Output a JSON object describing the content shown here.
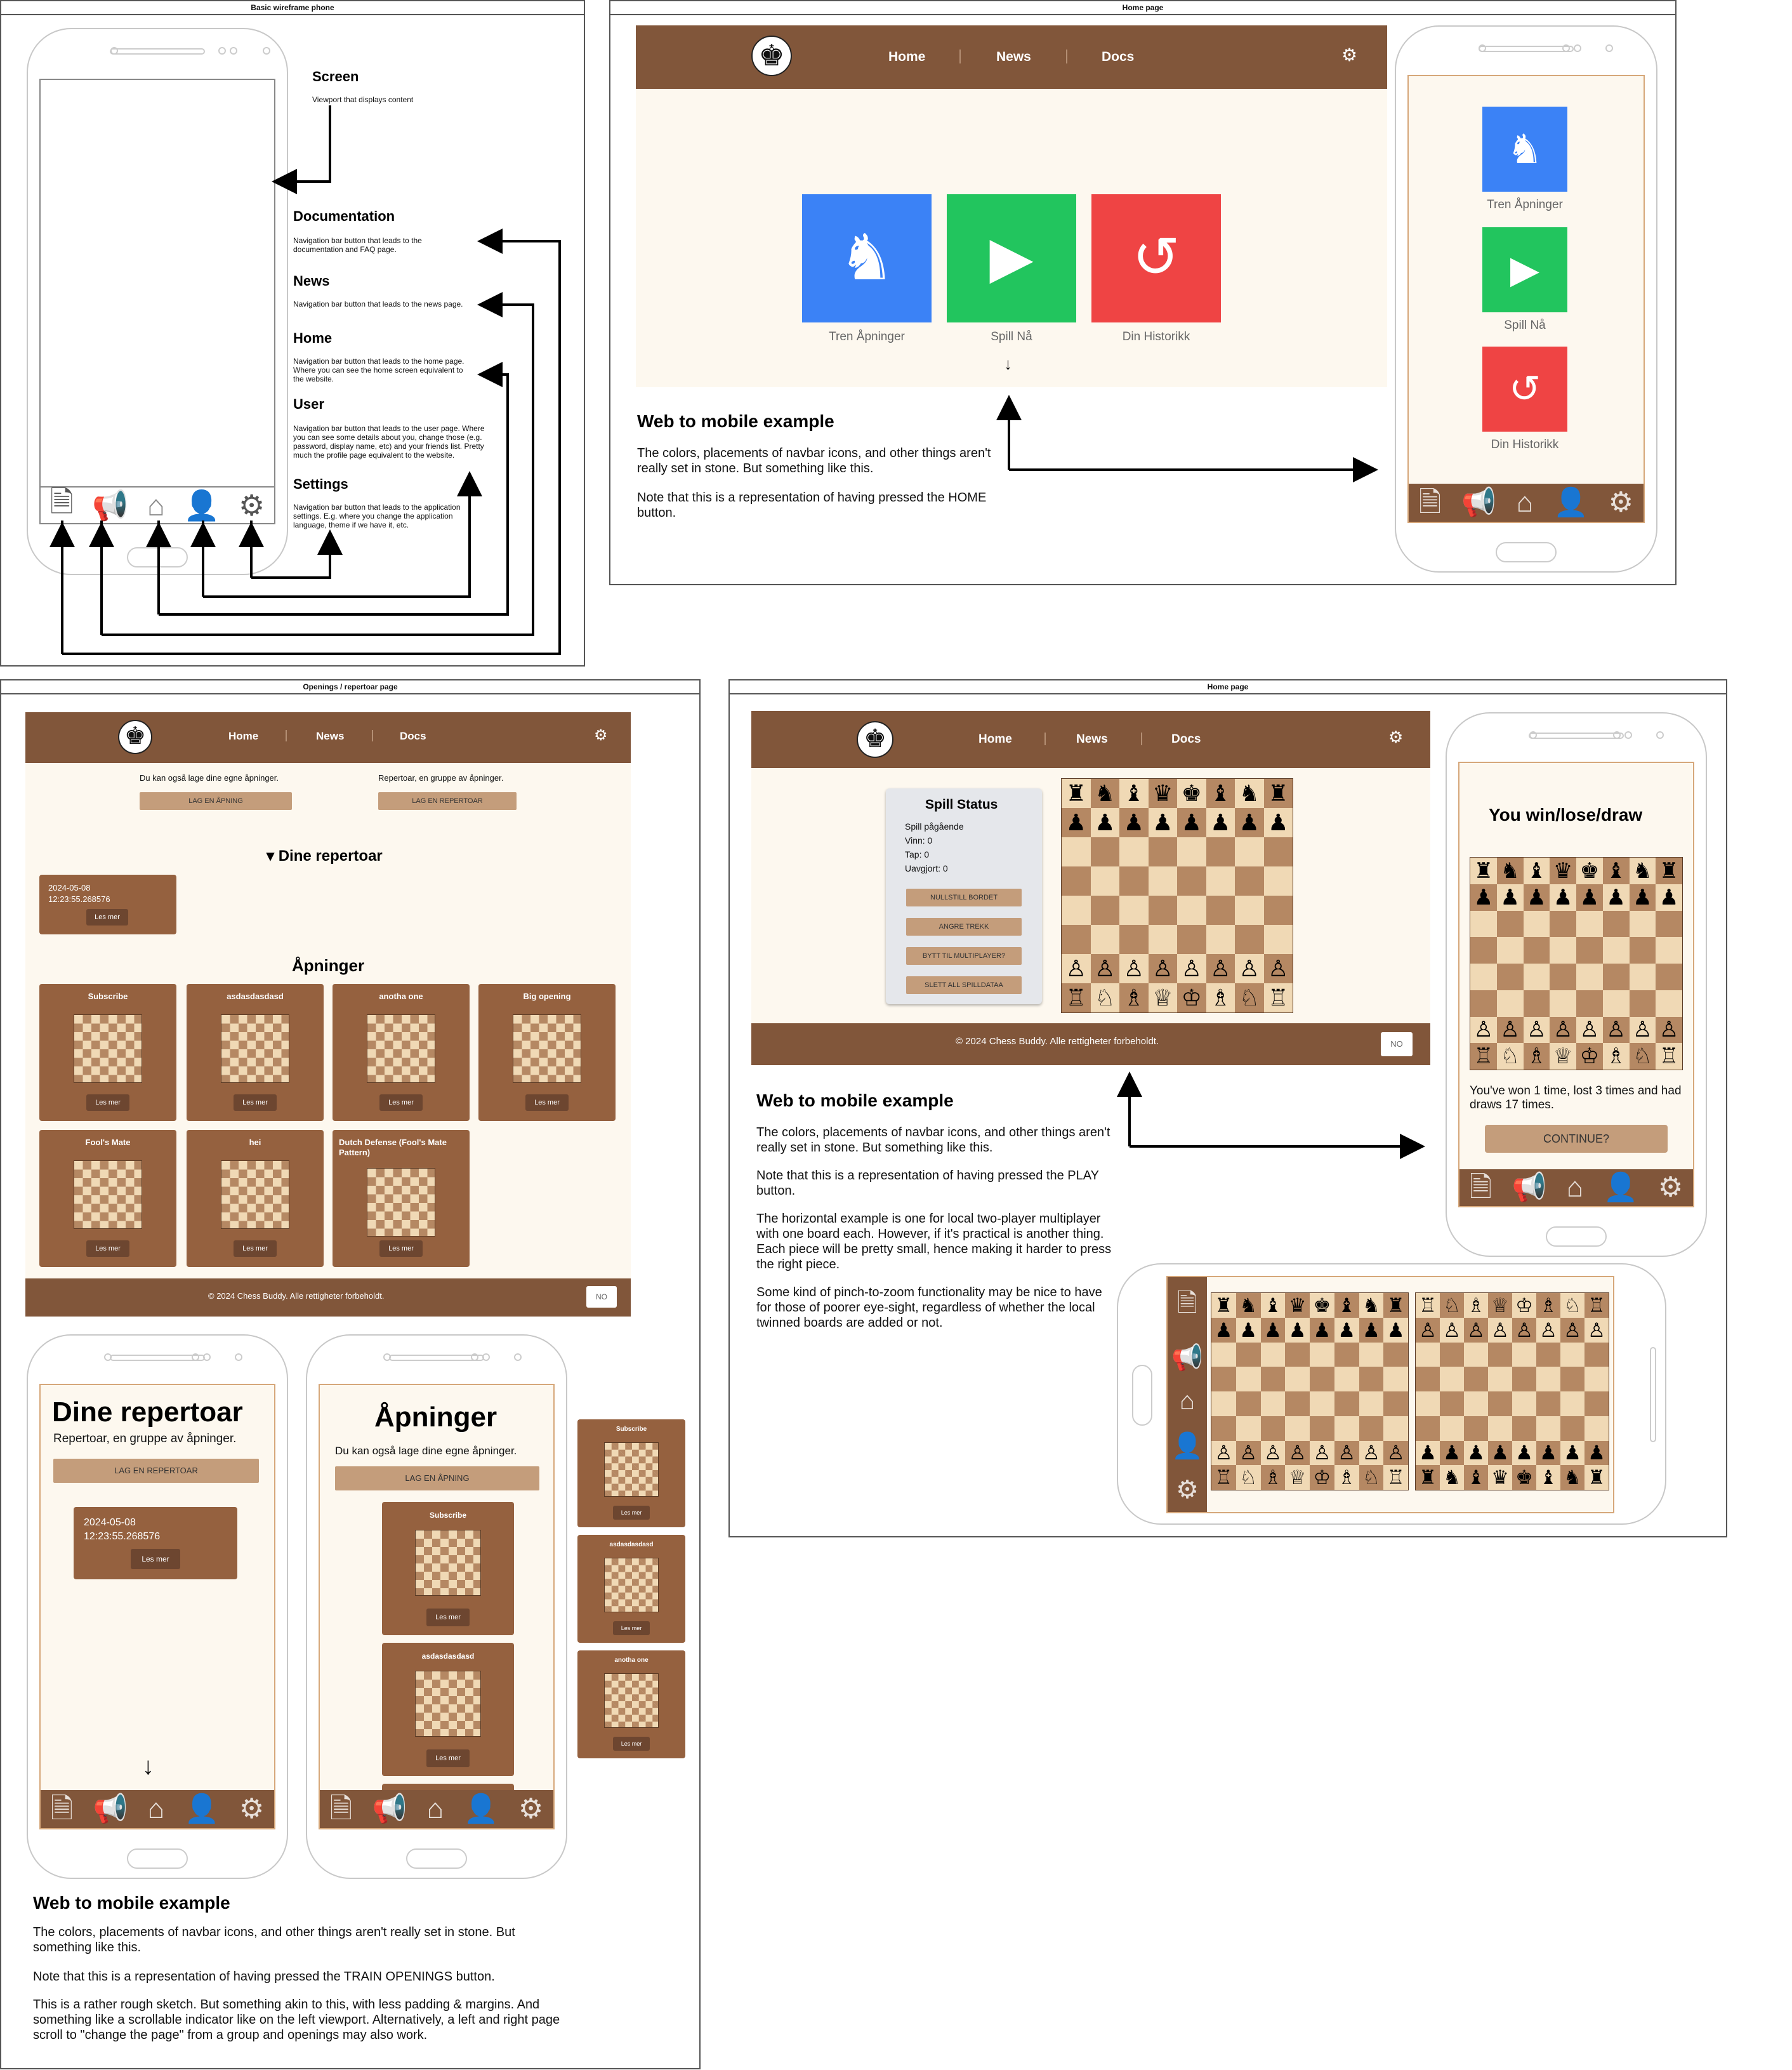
{
  "f1": {
    "title": "Basic wireframe phone",
    "screen_h": "Screen",
    "screen_d": "Viewport that displays content",
    "doc_h": "Documentation",
    "doc_d": "Navigation bar button that leads to the documentation and FAQ page.",
    "news_h": "News",
    "news_d": "Navigation bar button that leads to the news page.",
    "home_h": "Home",
    "home_d": "Navigation bar button that leads to the home page. Where you can see the home screen equivalent to the website.",
    "user_h": "User",
    "user_d": "Navigation bar button that leads to the user page. Where you can see some details about you, change those (e.g. password, display name, etc) and your friends list. Pretty much the profile page equivalent to the website.",
    "set_h": "Settings",
    "set_d": "Navigation bar button that leads to the application settings. E.g. where you change the application language, theme if we have it, etc."
  },
  "nav": {
    "home": "Home",
    "news": "News",
    "docs": "Docs"
  },
  "f2": {
    "title": "Home page",
    "tiles": [
      "Tren Åpninger",
      "Spill Nå",
      "Din Historikk"
    ],
    "wt": "Web to mobile example",
    "w1": "The colors, placements of navbar icons, and other things aren't really set in stone. But something like this.",
    "w2": "Note that this is a representation of having pressed the HOME button."
  },
  "f3": {
    "title": "Openings / repertoar page",
    "create_own": "Du kan også lage dine egne åpninger.",
    "rep_desc": "Repertoar, en gruppe av åpninger.",
    "btn_open": "LAG EN ÅPNING",
    "btn_rep": "LAG EN REPERTOAR",
    "dine": "▾ Dine repertoar",
    "dine_m": "Dine repertoar",
    "rep_date": "2024-05-08",
    "rep_time": "12:23:55.268576",
    "les": "Les mer",
    "apn": "Åpninger",
    "cards": [
      "Subscribe",
      "asdasdasdasd",
      "anotha one",
      "Big opening",
      "Fool's Mate",
      "hei",
      "Dutch Defense (Fool's Mate Pattern)"
    ],
    "footer": "© 2024 Chess Buddy. Alle rettigheter forbeholdt.",
    "lang": "NO",
    "wt": "Web to mobile example",
    "w1": "The colors, placements of navbar icons, and other things aren't really set in stone. But something like this.",
    "w2": "Note that this is a representation of having pressed the TRAIN OPENINGS button.",
    "w3": "This is a rather rough sketch. But something akin to this, with less padding & margins. And something like a scrollable indicator like on the left viewport. Alternatively, a left and right page scroll to \"change the page\" from a group and openings may also work."
  },
  "f4": {
    "title": "Home page",
    "status": "Spill Status",
    "s1": "Spill pågående",
    "s2": "Vinn: 0",
    "s3": "Tap: 0",
    "s4": "Uavgjort: 0",
    "b1": "NULLSTILL BORDET",
    "b2": "ANGRE TREKK",
    "b3": "BYTT TIL MULTIPLAYER?",
    "b4": "SLETT ALL SPILLDATAA",
    "footer": "© 2024 Chess Buddy. Alle rettigheter forbeholdt.",
    "lang": "NO",
    "win": "You win/lose/draw",
    "res": "You've won 1 time, lost 3 times and had draws 17 times.",
    "cont": "CONTINUE?",
    "wt": "Web to mobile example",
    "w1": "The colors, placements of navbar icons, and other things aren't really set in stone. But something like this.",
    "w2": "Note that this is a representation of having pressed the PLAY button.",
    "w3": "The horizontal example is one for local two-player multiplayer with one board each. However, if it's practical is another thing. Each piece will be pretty small, hence making it harder to press the right piece.",
    "w4": "Some kind of pinch-to-zoom functionality may be nice to have for those of poorer eye-sight, regardless of whether the local twinned boards are added or not."
  },
  "colors": {
    "brown": "#81563a",
    "card": "#95613f",
    "cream": "#fdf8ef",
    "blue": "#3b82f6",
    "green": "#22c55e",
    "red": "#ef4444",
    "btn": "#c49d7b"
  },
  "icons": [
    "document-icon",
    "megaphone-icon",
    "home-icon",
    "user-icon",
    "gear-icon",
    "knight-icon",
    "play-icon",
    "history-icon",
    "logo-icon",
    "down-arrow-icon"
  ]
}
